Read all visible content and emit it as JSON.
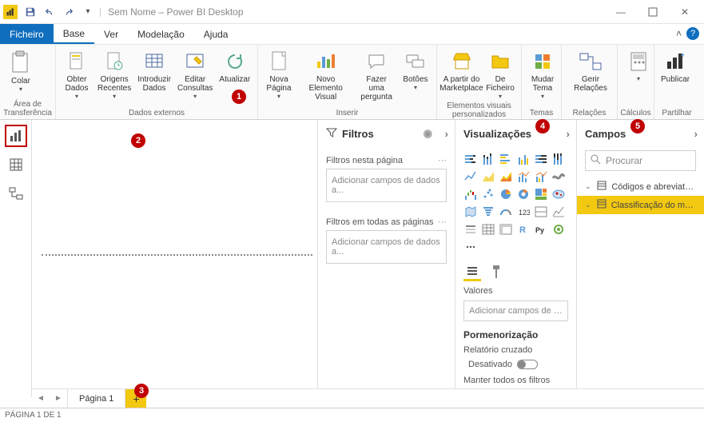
{
  "titlebar": {
    "title": "Sem Nome – Power BI Desktop"
  },
  "menu": {
    "file": "Ficheiro",
    "base": "Base",
    "view": "Ver",
    "model": "Modelação",
    "help": "Ajuda"
  },
  "ribbon": {
    "clipboard": {
      "paste": "Colar",
      "label": "Área de\nTransferência"
    },
    "external_data": {
      "get_data": "Obter\nDados",
      "recent": "Origens\nRecentes",
      "enter": "Introduzir\nDados",
      "edit": "Editar\nConsultas",
      "refresh": "Atualizar",
      "label": "Dados externos"
    },
    "insert": {
      "page": "Nova\nPágina",
      "visual": "Novo Elemento\nVisual",
      "ask": "Fazer uma\npergunta",
      "buttons": "Botões",
      "label": "Inserir"
    },
    "custom": {
      "mkt": "A partir do\nMarketplace",
      "file": "De\nFicheiro",
      "label": "Elementos visuais\npersonalizados"
    },
    "themes": {
      "switch": "Mudar\nTema",
      "label": "Temas"
    },
    "relations": {
      "manage": "Gerir Relações",
      "label": "Relações"
    },
    "calc": {
      "label": "Cálculos"
    },
    "share": {
      "publish": "Publicar",
      "label": "Partilhar"
    }
  },
  "filters": {
    "title": "Filtros",
    "page_label": "Filtros nesta página",
    "all_label": "Filtros em todas as páginas",
    "placeholder": "Adicionar campos de dados a..."
  },
  "viz": {
    "title": "Visualizações",
    "values": "Valores",
    "add_field": "Adicionar campos de dado...",
    "drill": "Pormenorização",
    "cross": "Relatório cruzado",
    "off": "Desativado",
    "keep": "Manter todos os filtros"
  },
  "fields": {
    "title": "Campos",
    "search": "Procurar",
    "items": [
      {
        "label": "Códigos e abreviaturas"
      },
      {
        "label": "Classificação do melho..."
      }
    ]
  },
  "pages": {
    "page1": "Página 1"
  },
  "status": "PÁGINA 1 DE 1",
  "markers": {
    "m1": "1",
    "m2": "2",
    "m3": "3",
    "m4": "4",
    "m5": "5"
  }
}
